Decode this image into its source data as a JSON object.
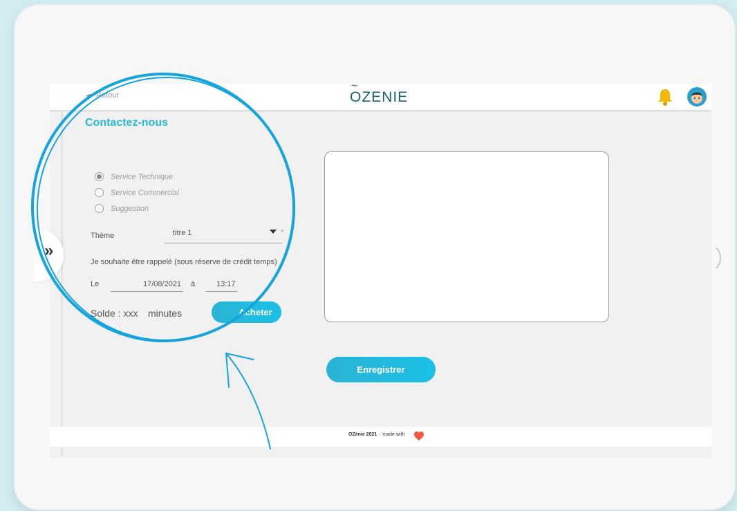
{
  "header": {
    "back_label": "Retour",
    "logo": "ZENIE",
    "logo_mark": "O"
  },
  "form": {
    "title": "Contactez-nous",
    "radios": [
      {
        "label": "Service Technique",
        "checked": true
      },
      {
        "label": "Service Commercial",
        "checked": false
      },
      {
        "label": "Suggestion",
        "checked": false
      }
    ],
    "theme_label": "Thème",
    "theme_value": "titre 1",
    "required_mark": "*",
    "callback_label": "Je souhaite être rappelé (sous réserve de crédit temps)",
    "date_prefix": "Le",
    "date_value": "17/08/2021",
    "at_label": "à",
    "time_value": "13:17",
    "balance_label": "Solde :",
    "balance_value": "xxx",
    "balance_unit": "minutes",
    "buy_button": "Acheter",
    "save_button": "Enregistrer"
  },
  "footer": {
    "brand": "OZénie 2021",
    "made_with": "· made with"
  },
  "sidetab": {
    "icon": "»"
  },
  "colors": {
    "accent": "#2ab7cf",
    "button": "#1bb9e0",
    "ring": "#15a4db",
    "heart": "#f0573c",
    "bell": "#f5b800"
  },
  "icons": [
    "back-triangle-icon",
    "bell-icon",
    "avatar",
    "double-chevron-right-icon",
    "heart-icon",
    "chevron-right-icon"
  ]
}
